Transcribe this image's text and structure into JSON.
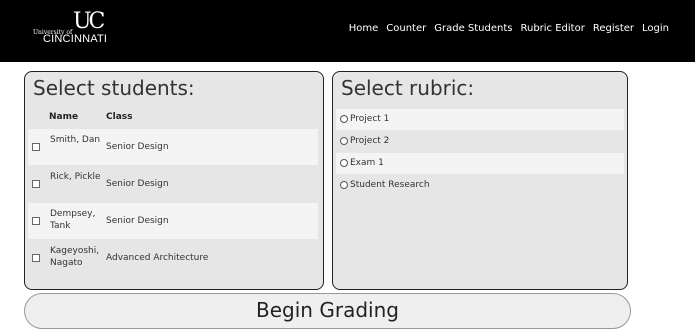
{
  "brand": {
    "university": "University of",
    "name": "CINCINNATI",
    "mark": "UC"
  },
  "nav": [
    "Home",
    "Counter",
    "Grade Students",
    "Rubric Editor",
    "Register",
    "Login"
  ],
  "students_panel": {
    "title": "Select students:",
    "headers": {
      "name": "Name",
      "class": "Class"
    },
    "rows": [
      {
        "name": "Smith, Dan",
        "class": "Senior Design",
        "checked": false
      },
      {
        "name": "Rick, Pickle",
        "class": "Senior Design",
        "checked": false
      },
      {
        "name": "Dempsey, Tank",
        "class": "Senior Design",
        "checked": false
      },
      {
        "name": "Kageyoshi, Nagato",
        "class": "Advanced Architecture",
        "checked": false
      }
    ]
  },
  "rubric_panel": {
    "title": "Select rubric:",
    "options": [
      "Project 1",
      "Project 2",
      "Exam 1",
      "Student Research"
    ]
  },
  "begin_button": "Begin Grading"
}
